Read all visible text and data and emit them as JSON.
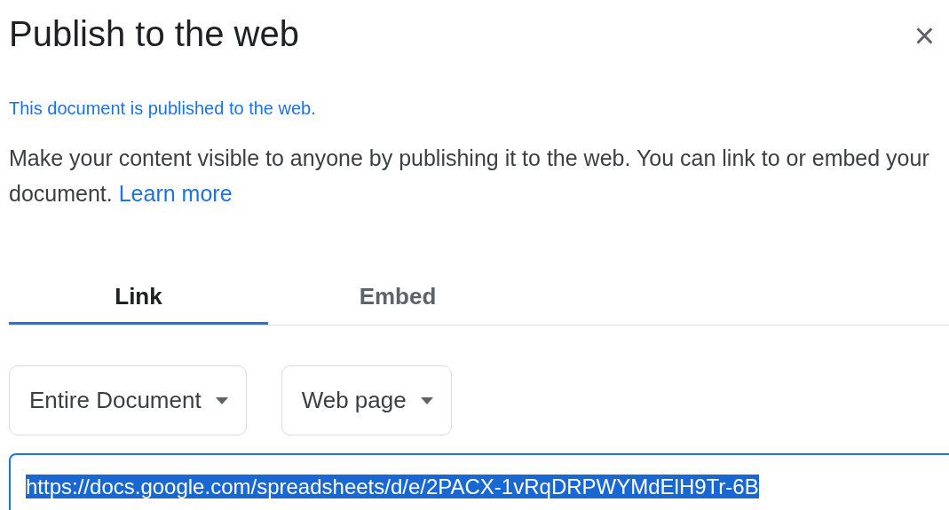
{
  "dialog": {
    "title": "Publish to the web",
    "close": "×"
  },
  "status": "This document is published to the web.",
  "description": {
    "text": "Make your content visible to anyone by publishing it to the web. You can link to or embed your document.",
    "link": "Learn more"
  },
  "tabs": [
    {
      "label": "Link",
      "selected": true
    },
    {
      "label": "Embed",
      "selected": false
    }
  ],
  "dropdowns": [
    {
      "value": "Entire Document"
    },
    {
      "value": "Web page"
    }
  ],
  "link_field": {
    "value": "https://docs.google.com/spreadsheets/d/e/2PACX-1vRqDRPWYMdElH9Tr-6B",
    "text_selected": true
  }
}
